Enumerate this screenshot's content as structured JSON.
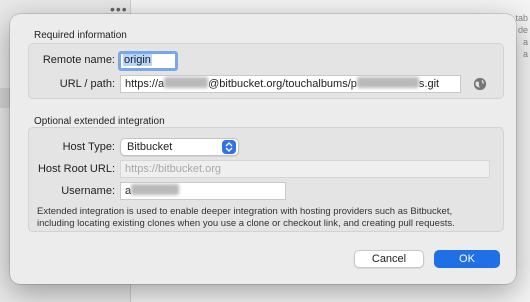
{
  "background": {
    "menu_dots": "•••",
    "peek_lines": [
      "tab",
      "de",
      "a",
      "a"
    ]
  },
  "dialog": {
    "required": {
      "title": "Required information",
      "remote_name_label": "Remote name:",
      "remote_name_value": "origin",
      "url_label": "URL / path:",
      "url_prefix": "https://a",
      "url_middle": "@bitbucket.org/touchalbums/p",
      "url_suffix": "s.git"
    },
    "optional": {
      "title": "Optional extended integration",
      "host_type_label": "Host Type:",
      "host_type_value": "Bitbucket",
      "host_root_label": "Host Root URL:",
      "host_root_placeholder": "https://bitbucket.org",
      "username_label": "Username:",
      "username_prefix": "a",
      "description": "Extended integration is used to enable deeper integration with hosting providers such as Bitbucket, including locating existing clones when you use a clone or checkout link, and creating pull requests."
    },
    "buttons": {
      "cancel": "Cancel",
      "ok": "OK"
    }
  },
  "colors": {
    "accent": "#1f6fe6",
    "focus_ring": "#7aa7e8"
  },
  "icons": [
    "globe-icon",
    "chevron-updown-icon"
  ]
}
